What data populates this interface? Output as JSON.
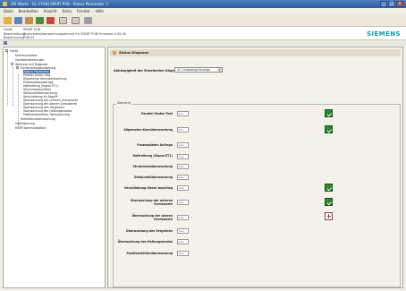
{
  "window": {
    "title": "ZIS Works · [0, 2TUN] SPART PUB · Status Parameter ·]",
    "controls": [
      "_",
      "□",
      "x"
    ]
  },
  "menu": [
    "Datei",
    "Bearbeiten",
    "Ansicht",
    "Extra",
    "Fenster",
    "Hilfe"
  ],
  "info": {
    "rows": [
      {
        "label": "Gerät",
        "value": "SPART PUB"
      },
      {
        "label": "Beschreibung",
        "value": "Sicherheitsüberwachungseinheit für SPART PUB Firmware 4.00.00"
      },
      {
        "label": "Bezeichnung",
        "value": "PUB 02"
      }
    ],
    "brand": "SIEMENS",
    "brand_color": "#0d9aa5"
  },
  "tree": {
    "items": [
      {
        "text": "Gerät",
        "level": 0
      },
      {
        "text": "Kommunikation",
        "level": 1
      },
      {
        "text": "Geräteeinstellungen",
        "level": 1
      },
      {
        "text": "Wartung und Diagnose",
        "level": 1
      },
      {
        "text": "Sicherheitsüberwachung",
        "level": 2
      },
      {
        "text": "Status Parameter",
        "level": 3,
        "selected": true
      },
      {
        "text": "Parallel Stufen Test",
        "level": 3
      },
      {
        "text": "Allgemeine Kennüberwachung",
        "level": 3
      },
      {
        "text": "Prozessdatenabfrage",
        "level": 3
      },
      {
        "text": "Haftreibung (Signal ET1)",
        "level": 3
      },
      {
        "text": "Strommessfunktion",
        "level": 3
      },
      {
        "text": "Stellpunktüberwachung",
        "level": 3
      },
      {
        "text": "Verschiebung im Abgriff",
        "level": 3
      },
      {
        "text": "Überwachung der unteren Grenzwerte",
        "level": 3
      },
      {
        "text": "Überwachung der oberen Grenzwerte",
        "level": 3
      },
      {
        "text": "Überwachung des Vergleichs",
        "level": 3
      },
      {
        "text": "Überwachung der Haltungsmodus",
        "level": 3
      },
      {
        "text": "Positionskorrektur Überwachung",
        "level": 3
      },
      {
        "text": "Verhaltensüberwachung",
        "level": 2
      },
      {
        "text": "Initialisierung",
        "level": 1
      },
      {
        "text": "HART Kommunikation",
        "level": 1
      }
    ]
  },
  "panel": {
    "title": "Status Diagnose",
    "select_label": "Abhängigkeit der Erweiterten Diagnose",
    "select_value": "Uf / Unbedingt Anzeige",
    "group_label": "Übersicht",
    "params": [
      {
        "label": "Parallel Stufen Test",
        "value": "Ein",
        "status": "ok"
      },
      {
        "label": "Allgemeine Kennüberwachung",
        "value": "Ein",
        "status": "ok"
      },
      {
        "label": "Prozessdaten Anfrage",
        "value": "Aus",
        "status": ""
      },
      {
        "label": "Haftreibung (Signal ET1)",
        "value": "Aus",
        "status": ""
      },
      {
        "label": "Strommessüberwachung",
        "value": "Aus",
        "status": ""
      },
      {
        "label": "Stellpunktüberwachung",
        "value": "Aus",
        "status": ""
      },
      {
        "label": "Verschiebung dieser Anschlag",
        "value": "Aus",
        "status": "ok"
      },
      {
        "label": "Überwachung der unteren Grenzwerte",
        "value": "Aus",
        "status": "ok"
      },
      {
        "label": "Überwachung der oberen Grenzwerte",
        "value": "Aus",
        "status": "warn"
      },
      {
        "label": "Überwachung des Vergleichs",
        "value": "Aus",
        "status": ""
      },
      {
        "label": "Überwachung des Haltungsmodus",
        "value": "Aus",
        "status": ""
      },
      {
        "label": "Positionsfehlerüberwachung",
        "value": "Aus",
        "status": ""
      }
    ]
  }
}
